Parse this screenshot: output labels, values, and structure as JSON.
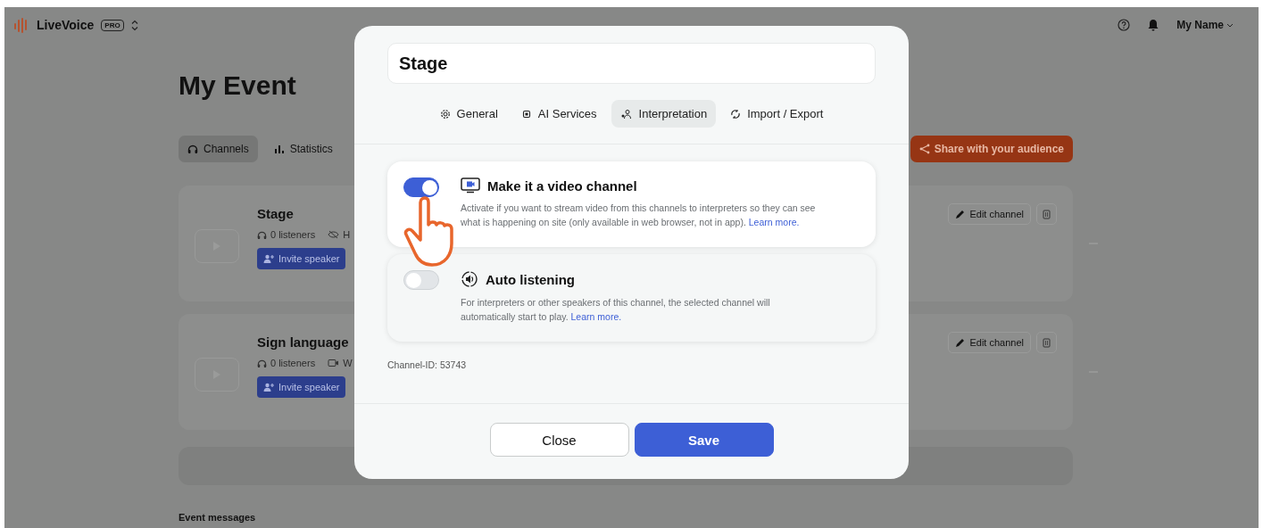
{
  "app": {
    "logo": "LiveVoice",
    "plan_badge": "PRO"
  },
  "header": {
    "user_name": "My Name"
  },
  "event": {
    "title": "My Event",
    "tabs": [
      {
        "label": "Channels",
        "selected": true
      },
      {
        "label": "Statistics",
        "selected": false
      }
    ],
    "share_button": "Share with your audience",
    "channels": [
      {
        "name": "Stage",
        "listeners": "0 listeners",
        "detail": "H",
        "invite_button": "Invite speaker",
        "edit_button": "Edit channel"
      },
      {
        "name": "Sign language",
        "listeners": "0 listeners",
        "detail": "W",
        "invite_button": "Invite speaker",
        "edit_button": "Edit channel"
      }
    ]
  },
  "event_messages": "Event messages",
  "dialog": {
    "name_value": "Stage",
    "tabs": [
      {
        "label": "General",
        "selected": false
      },
      {
        "label": "AI Services",
        "selected": false
      },
      {
        "label": "Interpretation",
        "selected": true
      },
      {
        "label": "Import / Export",
        "selected": false
      }
    ],
    "settings": [
      {
        "kind": "video",
        "title": "Make it a video channel",
        "description": "Activate if you want to stream video from this channels to interpreters so they can see what is happening on site (only available in web browser, not in app).",
        "link": "Learn more.",
        "on": true
      },
      {
        "kind": "audio",
        "title": "Auto listening",
        "description": "For interpreters or other speakers of this channel, the selected channel will automatically start to play.",
        "link": "Learn more.",
        "on": false
      }
    ],
    "channel_id": "Channel-ID: 53743",
    "buttons": [
      {
        "label": "Close",
        "kind": "secondary"
      },
      {
        "label": "Save",
        "kind": "primary"
      }
    ]
  }
}
